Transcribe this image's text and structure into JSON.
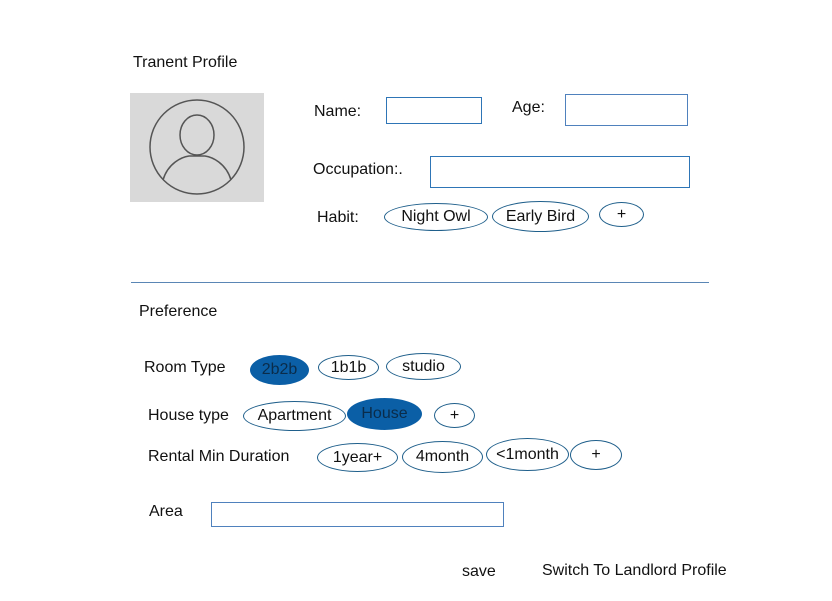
{
  "profile": {
    "title": "Tranent Profile",
    "name_label": "Name:",
    "age_label": "Age:",
    "occupation_label": "Occupation:.",
    "habit_label": "Habit:",
    "habits": [
      "Night Owl",
      "Early Bird",
      "+"
    ]
  },
  "preference": {
    "title": "Preference",
    "room_type_label": "Room Type",
    "room_types": [
      {
        "label": "2b2b",
        "selected": true
      },
      {
        "label": "1b1b",
        "selected": false
      },
      {
        "label": "studio",
        "selected": false
      }
    ],
    "house_type_label": "House type",
    "house_types": [
      {
        "label": "Apartment",
        "selected": false
      },
      {
        "label": "House",
        "selected": true
      },
      {
        "label": "+",
        "selected": false
      }
    ],
    "duration_label": "Rental Min Duration",
    "durations": [
      "1year+",
      "4month",
      "<1month",
      "+"
    ],
    "area_label": "Area"
  },
  "actions": {
    "save": "save",
    "switch": "Switch To Landlord Profile"
  },
  "colors": {
    "accent": "#0b5fa6",
    "chip_outline": "#1f5f8b",
    "avatar_bg": "#d9d9d9"
  }
}
